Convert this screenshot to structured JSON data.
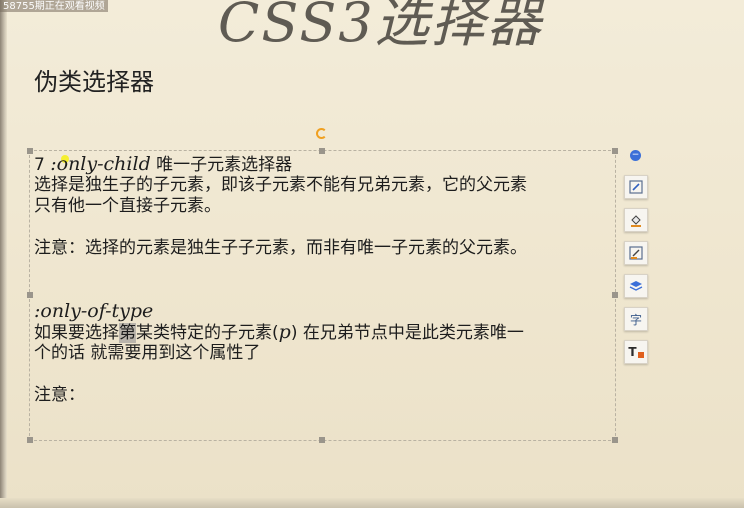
{
  "overlay": {
    "text": "58755期正在观看视频"
  },
  "slide": {
    "title": "CSS3选择器",
    "section_heading": "伪类选择器"
  },
  "content": {
    "heading1_num": "7 ",
    "heading1_code": ":only-child",
    "heading1_desc": " 唯一子元素选择器",
    "p1_line1": "选择是独生子的子元素，即该子元素不能有兄弟元素，它的父元素",
    "p1_line2": "只有他一个直接子元素。",
    "note1": "注意：选择的元素是独生子子元素，而非有唯一子元素的父元素。",
    "heading2_code": ":only-of-type",
    "p2_line1_a": "如果要选择",
    "p2_line1_hl": "第",
    "p2_line1_b": "某类特定的子元素(",
    "p2_line1_p": "p",
    "p2_line1_c": ") 在兄弟节点中是此类元素唯一",
    "p2_line2": "个的话 就需要用到这个属性了",
    "note2": "注意："
  },
  "toolbar": {
    "tools": [
      {
        "icon": "minus-circle-icon"
      },
      {
        "icon": "edit-box-icon"
      },
      {
        "icon": "fill-bucket-icon"
      },
      {
        "icon": "pen-icon"
      },
      {
        "icon": "layers-icon"
      },
      {
        "icon": "text-style-icon",
        "label": "字"
      },
      {
        "icon": "text-color-icon",
        "label": "T"
      }
    ],
    "accent": "#3b6fd8"
  }
}
